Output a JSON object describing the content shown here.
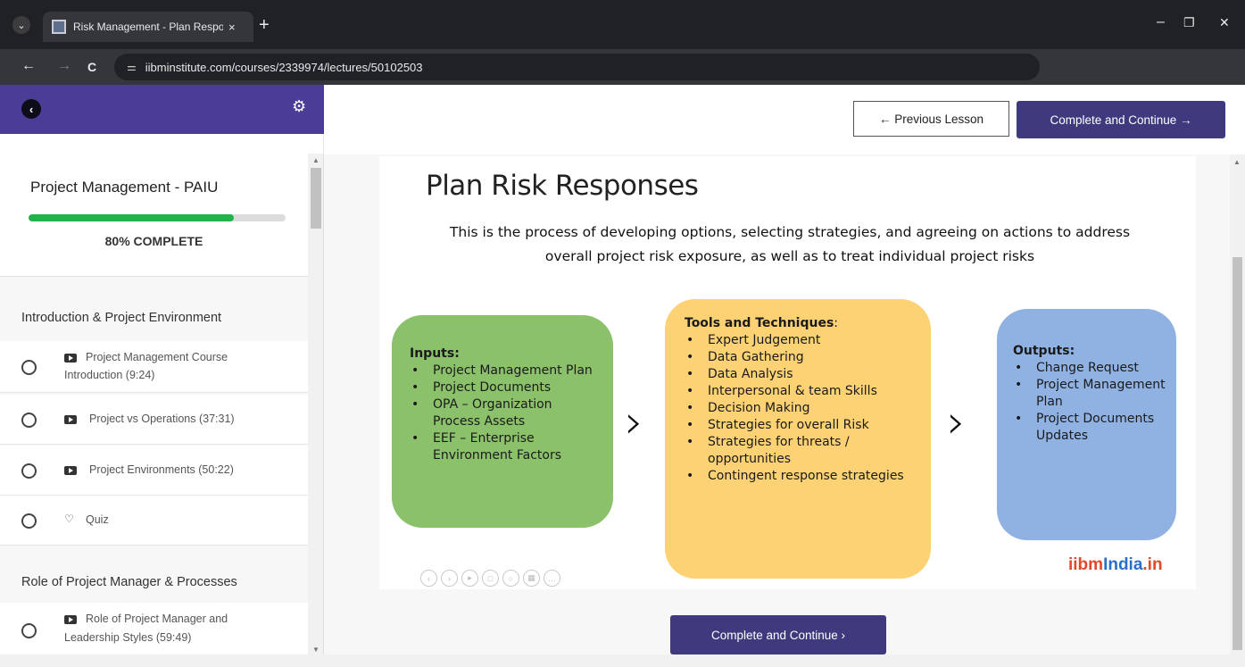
{
  "browser": {
    "tab_title": "Risk Management - Plan Respo",
    "close_glyph": "×",
    "new_tab_glyph": "+",
    "url": "iibminstitute.com/courses/2339974/lectures/50102503",
    "minimize_glyph": "–",
    "restore_glyph": "❐",
    "close_window_glyph": "✕",
    "back_glyph": "←",
    "forward_glyph": "→",
    "reload_glyph": "C"
  },
  "sidebar": {
    "course_title": "Project Management - PAIU",
    "progress_percent": 80,
    "progress_label": "80% COMPLETE",
    "sections": [
      {
        "title": "Introduction & Project Environment",
        "lectures": [
          {
            "label": "Project Management Course Introduction (9:24)",
            "line1": "Project Management Course",
            "line2": "Introduction (9:24)",
            "type": "video"
          },
          {
            "label": "Project vs Operations (37:31)",
            "type": "video"
          },
          {
            "label": "Project Environments (50:22)",
            "type": "video"
          },
          {
            "label": "Quiz",
            "type": "quiz"
          }
        ]
      },
      {
        "title": "Role of Project Manager & Processes",
        "lectures": [
          {
            "label": "Role of Project Manager and Leadership Styles (59:49)",
            "line1": "Role of Project Manager and",
            "line2": "Leadership Styles (59:49)",
            "type": "video"
          }
        ]
      }
    ]
  },
  "nav": {
    "previous_label": "← Previous Lesson",
    "complete_label": "Complete and Continue →",
    "bottom_complete_label": "Complete and Continue  ›"
  },
  "slide": {
    "title": "Plan Risk Responses",
    "description_line1": "This is the process of developing options, selecting strategies, and agreeing on actions to address",
    "description_line2": "overall project risk exposure, as well as to treat individual project risks",
    "inputs": {
      "heading": "Inputs:",
      "items": [
        "Project Management Plan",
        "Project Documents",
        "OPA – Organization Process Assets",
        "EEF – Enterprise Environment Factors"
      ]
    },
    "tools": {
      "heading": "Tools and Techniques",
      "heading_suffix": ":",
      "items": [
        "Expert Judgement",
        "Data Gathering",
        "Data Analysis",
        "Interpersonal & team Skills",
        "Decision Making",
        "Strategies for overall Risk",
        "Strategies for threats / opportunities",
        "Contingent response strategies"
      ]
    },
    "outputs": {
      "heading": "Outputs:",
      "items": [
        "Change Request",
        "Project Management Plan",
        "Project Documents Updates"
      ]
    },
    "arrow_glyph": "›",
    "brand_part1": "iibm",
    "brand_part2": "India",
    "brand_part3": ".in"
  },
  "colors": {
    "sidebar_header": "#4b3c96",
    "button": "#3f3a7d",
    "progress": "#21b24c",
    "inputs_box": "#8bc16a",
    "tools_box": "#fcd274",
    "outputs_box": "#8fb2e3"
  }
}
